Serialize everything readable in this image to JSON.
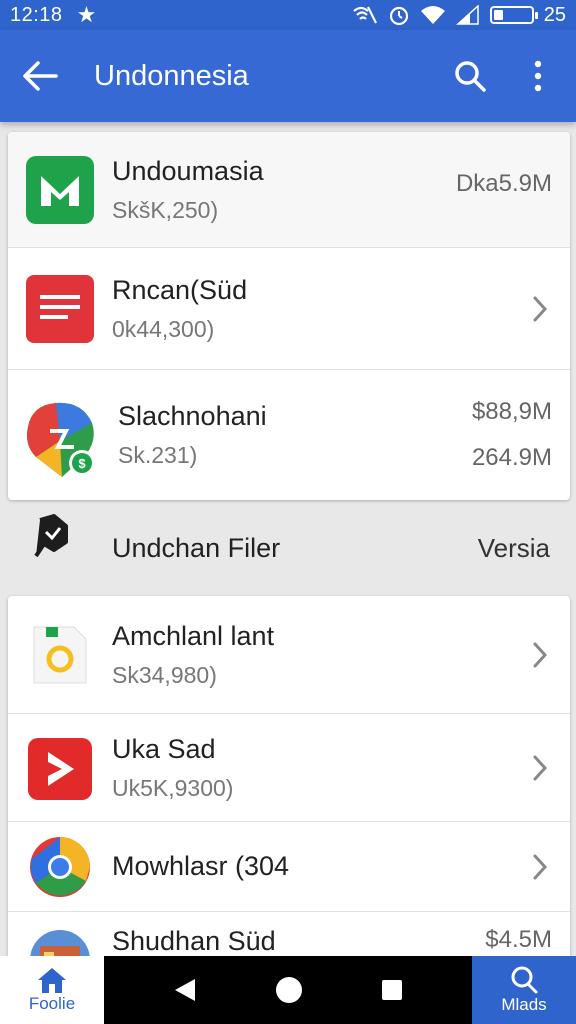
{
  "status": {
    "time": "12:18",
    "battery": "25",
    "battery_level": 0.25
  },
  "app_bar": {
    "title": "Undonnesia"
  },
  "top_apps": [
    {
      "name": "Undoumasia",
      "sub": "SkšK,250)",
      "meta1": "Dka5.9M",
      "meta2": ""
    },
    {
      "name": "Rncan(Süd",
      "sub": "0k44,300)"
    },
    {
      "name": "Slachnohani",
      "sub": "Sk.231)",
      "meta1": "$88,9M",
      "meta2": "264.9M"
    }
  ],
  "section": {
    "name": "Undchan Filer",
    "version": "Versia"
  },
  "bottom_apps": [
    {
      "name": "Amchlanl  lant",
      "sub": "Sk34,980)"
    },
    {
      "name": "Uka Sad",
      "sub": "Uk5K,9300)"
    },
    {
      "name": "Mowhlasr (304",
      "sub": ""
    },
    {
      "name": "Shudhan Süd",
      "meta1": "$4.5M"
    }
  ],
  "bottom_bar": {
    "home_label": "Foolie",
    "search_label": "Mlads"
  }
}
